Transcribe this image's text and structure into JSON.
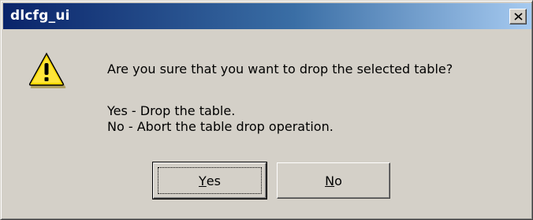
{
  "window": {
    "title": "dlcfg_ui"
  },
  "icons": {
    "close": "close-icon",
    "warning": "warning-icon"
  },
  "message": {
    "question": "Are you sure that you want to drop the selected table?",
    "yes_explanation": "Yes - Drop the table.",
    "no_explanation": "No - Abort the table drop operation."
  },
  "buttons": {
    "yes": {
      "mnemonic": "Y",
      "rest": "es"
    },
    "no": {
      "mnemonic": "N",
      "rest": "o"
    }
  },
  "colors": {
    "title_start": "#0a246a",
    "title_end": "#a6caf0",
    "face": "#d4d0c8",
    "warning_fill": "#ffd800"
  }
}
